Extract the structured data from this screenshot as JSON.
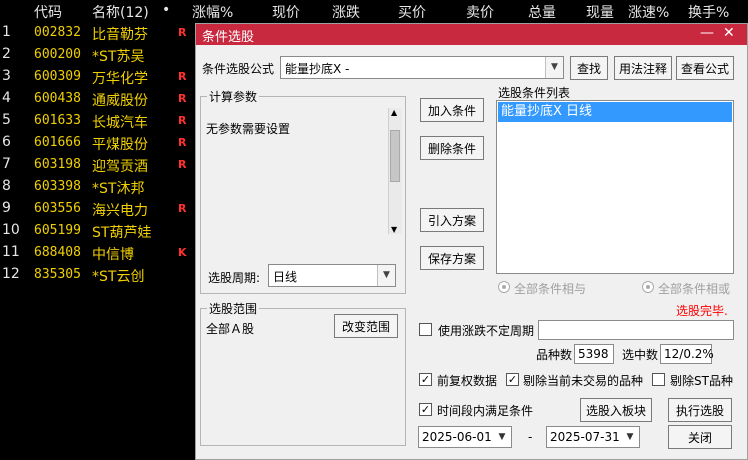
{
  "header": {
    "code": "代码",
    "name": "名称(12)",
    "dot": "•",
    "change_pct": "涨幅%",
    "price": "现价",
    "change": "涨跌",
    "bid": "买价",
    "ask": "卖价",
    "volume": "总量",
    "cur_volume": "现量",
    "speed": "涨速%",
    "turnover": "换手%"
  },
  "stocks": [
    {
      "num": "1",
      "code": "002832",
      "name": "比音勒芬",
      "flag": "R",
      "flag_color": "#ff3030"
    },
    {
      "num": "2",
      "code": "600200",
      "name": "*ST苏吴",
      "flag": "",
      "flag_color": "#ff3030"
    },
    {
      "num": "3",
      "code": "600309",
      "name": "万华化学",
      "flag": "R",
      "flag_color": "#ff3030"
    },
    {
      "num": "4",
      "code": "600438",
      "name": "通威股份",
      "flag": "R",
      "flag_color": "#ff3030"
    },
    {
      "num": "5",
      "code": "601633",
      "name": "长城汽车",
      "flag": "R",
      "flag_color": "#ff3030"
    },
    {
      "num": "6",
      "code": "601666",
      "name": "平煤股份",
      "flag": "R",
      "flag_color": "#ff3030"
    },
    {
      "num": "7",
      "code": "603198",
      "name": "迎驾贡酒",
      "flag": "R",
      "flag_color": "#ff3030"
    },
    {
      "num": "8",
      "code": "603398",
      "name": "*ST沐邦",
      "flag": "",
      "flag_color": "#ff3030"
    },
    {
      "num": "9",
      "code": "603556",
      "name": "海兴电力",
      "flag": "R",
      "flag_color": "#ff3030"
    },
    {
      "num": "10",
      "code": "605199",
      "name": "ST葫芦娃",
      "flag": "",
      "flag_color": "#ff3030"
    },
    {
      "num": "11",
      "code": "688408",
      "name": "中信博",
      "flag": "K",
      "flag_color": "#ff3030"
    },
    {
      "num": "12",
      "code": "835305",
      "name": "*ST云创",
      "flag": "",
      "flag_color": "#ff3030"
    }
  ],
  "dialog": {
    "title": "条件选股",
    "minimize": "—",
    "close": "✕",
    "formula_label": "条件选股公式",
    "formula_value": "能量抄底X    -",
    "find_btn": "查找",
    "usage_btn": "用法注释",
    "view_btn": "查看公式",
    "params_title": "计算参数",
    "params_text": "无参数需要设置",
    "add_btn": "加入条件",
    "delete_btn": "删除条件",
    "import_btn": "引入方案",
    "save_btn": "保存方案",
    "list_title": "选股条件列表",
    "list_item": "能量抄底X  日线",
    "period_label": "选股周期:",
    "period_value": "日线",
    "radio_and": "全部条件相与",
    "radio_or": "全部条件相或",
    "status": "选股完毕.",
    "status_color": "#ff0000",
    "range_title": "选股范围",
    "range_value": "全部Ａ股",
    "change_range_btn": "改变范围",
    "use_period_label": "使用涨跌不定周期",
    "stock_count_label": "品种数",
    "stock_count": "5398",
    "selected_label": "选中数",
    "selected_value": "12/0.2%",
    "fq_label": "前复权数据",
    "exclude_untraded_label": "剔除当前未交易的品种",
    "exclude_st_label": "剔除ST品种",
    "time_range_label": "时间段内满足条件",
    "to_block_btn": "选股入板块",
    "execute_btn": "执行选股",
    "date_from": "2025-06-01",
    "date_sep": "-",
    "date_to": "2025-07-31",
    "close_btn": "关闭",
    "title_color": "#c9293f",
    "selection_color": "#3399ff"
  }
}
